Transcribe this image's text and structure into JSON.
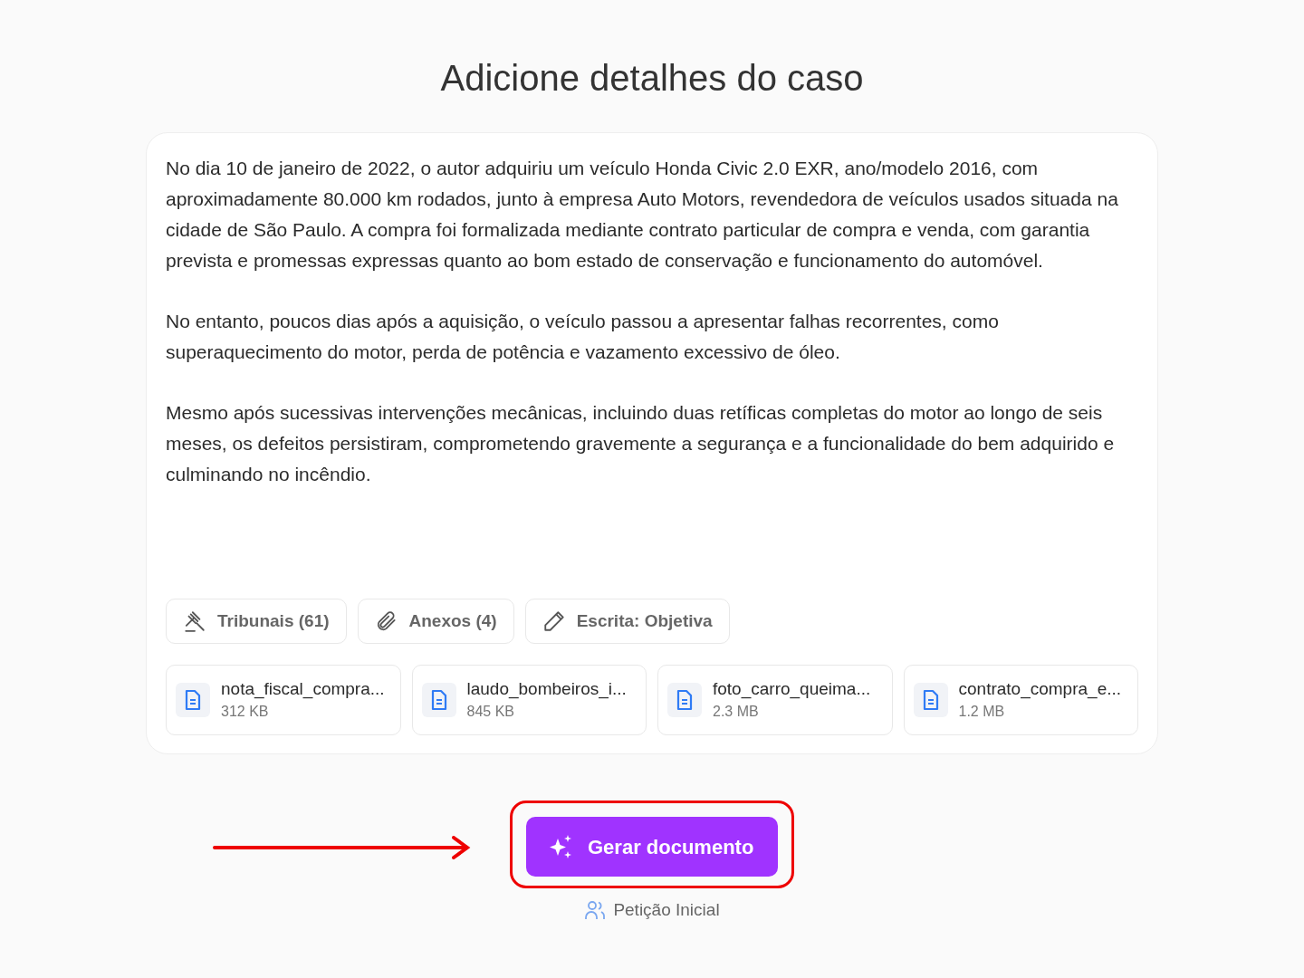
{
  "title": "Adicione detalhes do caso",
  "description": [
    "No dia 10 de janeiro de 2022, o autor adquiriu um veículo Honda Civic 2.0 EXR, ano/modelo 2016, com aproximadamente 80.000 km rodados, junto à empresa Auto Motors, revendedora de veículos usados situada na cidade de São Paulo. A compra foi formalizada mediante contrato particular de compra e venda, com garantia prevista e promessas expressas quanto ao bom estado de conservação e funcionamento do automóvel.",
    "No entanto, poucos dias após a aquisição, o veículo passou a apresentar falhas recorrentes, como superaquecimento do motor, perda de potência e vazamento excessivo de óleo.",
    "Mesmo após sucessivas intervenções mecânicas, incluindo duas retíficas completas do motor ao longo de seis meses, os defeitos persistiram, comprometendo gravemente a segurança e a funcionalidade do bem adquirido e culminando no incêndio."
  ],
  "options": [
    {
      "kind": "courts",
      "label": "Tribunais (61)"
    },
    {
      "kind": "attachments",
      "label": "Anexos (4)"
    },
    {
      "kind": "style",
      "label": "Escrita: Objetiva"
    }
  ],
  "files": [
    {
      "name": "nota_fiscal_compra...",
      "size": "312 KB"
    },
    {
      "name": "laudo_bombeiros_i...",
      "size": "845 KB"
    },
    {
      "name": "foto_carro_queima...",
      "size": "2.3 MB"
    },
    {
      "name": "contrato_compra_e...",
      "size": "1.2 MB"
    }
  ],
  "generate_button": {
    "label": "Gerar documento",
    "highlighted": true
  },
  "document_type": "Petição Inicial"
}
